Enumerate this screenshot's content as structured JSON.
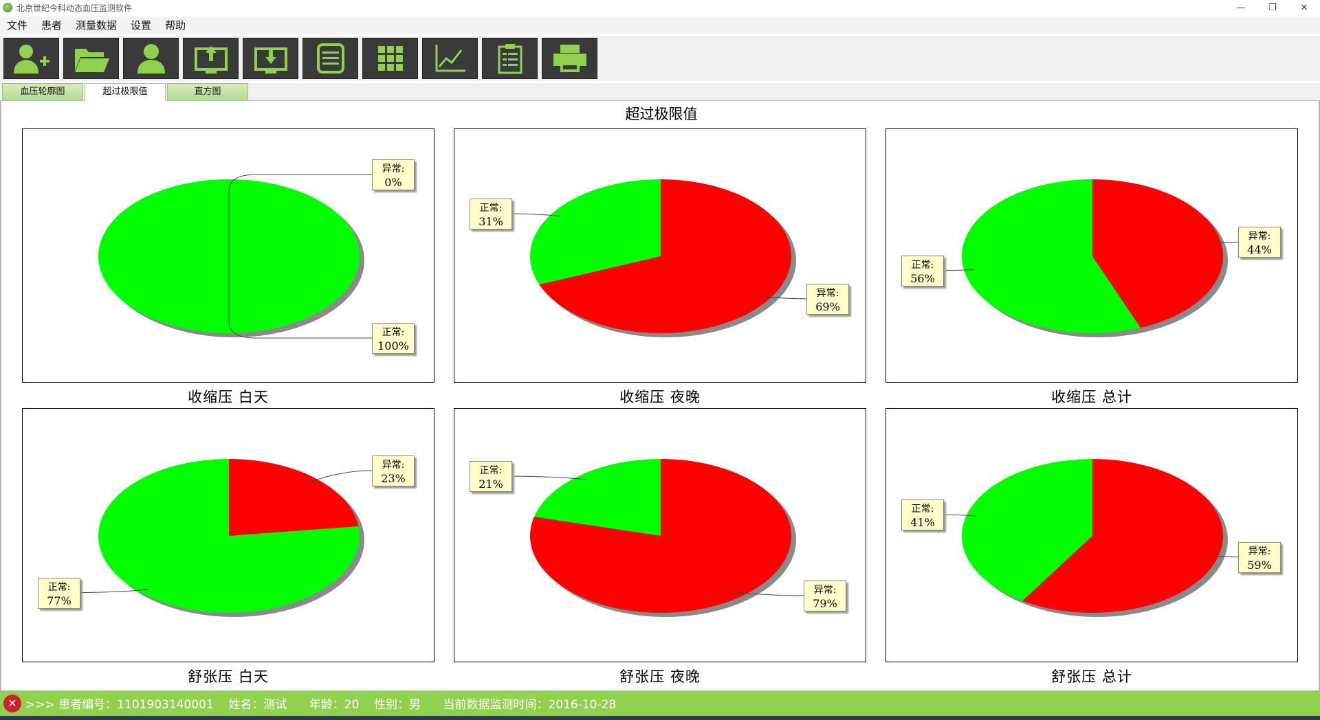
{
  "window": {
    "title": "北京世纪今科动态血压监测软件",
    "minimize": "—",
    "restore": "❐",
    "close": "✕"
  },
  "menu": [
    "文件",
    "患者",
    "测量数据",
    "设置",
    "帮助"
  ],
  "toolbar": [
    "add-patient-icon",
    "open-folder-icon",
    "patient-icon",
    "upload-icon",
    "download-icon",
    "list-icon",
    "grid-icon",
    "line-chart-icon",
    "clipboard-icon",
    "print-icon"
  ],
  "tabs": [
    {
      "label": "血压轮廓图",
      "active": false
    },
    {
      "label": "超过极限值",
      "active": true
    },
    {
      "label": "直方图",
      "active": false
    }
  ],
  "main_title": "超过极限值",
  "colors": {
    "normal": "#00ff00",
    "abnormal": "#ff0000",
    "status_bar": "#92d050"
  },
  "chart_data": [
    {
      "type": "pie",
      "title": "收缩压 白天",
      "slices": [
        {
          "label": "异常:",
          "value": 0,
          "text": "0%"
        },
        {
          "label": "正常:",
          "value": 100,
          "text": "100%"
        }
      ]
    },
    {
      "type": "pie",
      "title": "收缩压 夜晚",
      "slices": [
        {
          "label": "异常:",
          "value": 69,
          "text": "69%"
        },
        {
          "label": "正常:",
          "value": 31,
          "text": "31%"
        }
      ]
    },
    {
      "type": "pie",
      "title": "收缩压 总计",
      "slices": [
        {
          "label": "异常:",
          "value": 44,
          "text": "44%"
        },
        {
          "label": "正常:",
          "value": 56,
          "text": "56%"
        }
      ]
    },
    {
      "type": "pie",
      "title": "舒张压 白天",
      "slices": [
        {
          "label": "异常:",
          "value": 23,
          "text": "23%"
        },
        {
          "label": "正常:",
          "value": 77,
          "text": "77%"
        }
      ]
    },
    {
      "type": "pie",
      "title": "舒张压 夜晚",
      "slices": [
        {
          "label": "异常:",
          "value": 79,
          "text": "79%"
        },
        {
          "label": "正常:",
          "value": 21,
          "text": "21%"
        }
      ]
    },
    {
      "type": "pie",
      "title": "舒张压 总计",
      "slices": [
        {
          "label": "异常:",
          "value": 59,
          "text": "59%"
        },
        {
          "label": "正常:",
          "value": 41,
          "text": "41%"
        }
      ]
    }
  ],
  "status": {
    "icon": "close-circle-icon",
    "text": ">>> 患者编号：1101903140001    姓名：测试      年龄：20    性别：男      当前数据监测时间：2016-10-28"
  }
}
